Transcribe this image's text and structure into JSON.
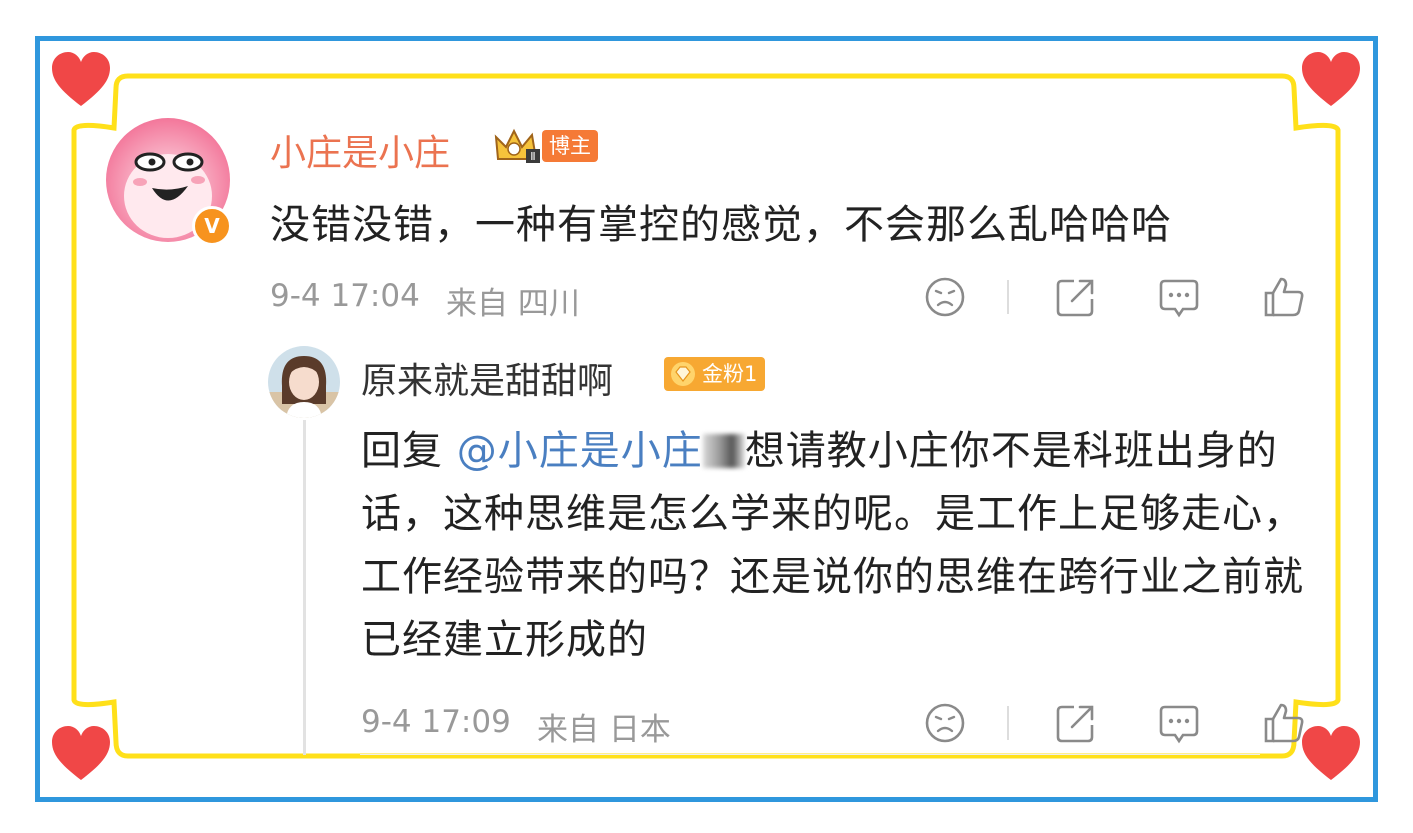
{
  "colors": {
    "frame_blue": "#2f97dd",
    "frame_yellow": "#ffe01a",
    "heart_red": "#f04747",
    "username_orange": "#eb7350",
    "mention_blue": "#4a7fc1",
    "meta_gray": "#999999",
    "blogger_tag": "#f57a36",
    "fan_badge": "#f7a832"
  },
  "comment": {
    "username": "小庄是小庄",
    "crown_icon": "crown-level-ii-icon",
    "role_tag": "博主",
    "verified_icon": "verified-v-icon",
    "text": "没错没错，一种有掌控的感觉，不会那么乱哈哈哈",
    "timestamp": "9-4 17:04",
    "source": "来自 四川",
    "actions": [
      "dislike-face-icon",
      "share-icon",
      "comment-icon",
      "like-thumb-icon"
    ]
  },
  "reply": {
    "username": "原来就是甜甜啊",
    "fan_badge": "金粉1",
    "reply_prefix": "回复",
    "mention": "@小庄是小庄",
    "text_after_mention": "想请教小庄你不是科班出身的话，这种思维是怎么学来的呢。是工作上足够走心，工作经验带来的吗？还是说你的思维在跨行业之前就已经建立形成的",
    "timestamp": "9-4 17:09",
    "source": "来自 日本",
    "actions": [
      "dislike-face-icon",
      "share-icon",
      "comment-icon",
      "like-thumb-icon"
    ]
  }
}
